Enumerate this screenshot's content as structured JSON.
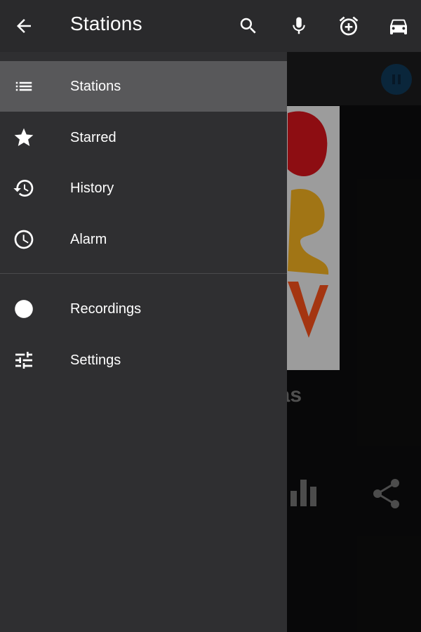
{
  "appbar": {
    "title": "Stations",
    "icons": [
      "back-arrow-icon",
      "search-icon",
      "microphone-icon",
      "alarm-add-icon",
      "car-icon"
    ]
  },
  "drawer": {
    "items": [
      {
        "label": "Stations",
        "icon": "list-icon",
        "active": true
      },
      {
        "label": "Starred",
        "icon": "star-icon"
      },
      {
        "label": "History",
        "icon": "history-icon"
      },
      {
        "label": "Alarm",
        "icon": "clock-icon"
      },
      {
        "label": "Recordings",
        "icon": "record-dot-icon"
      },
      {
        "label": "Settings",
        "icon": "tune-icon"
      }
    ]
  },
  "background": {
    "station_name_partial": "Milejas",
    "icons": [
      "pause-icon",
      "equalizer-icon",
      "share-icon"
    ]
  },
  "colors": {
    "appbar": "#2a2a2c",
    "drawer": "#2f2f31",
    "active_item": "#58585a",
    "accent": "#0f3552"
  }
}
